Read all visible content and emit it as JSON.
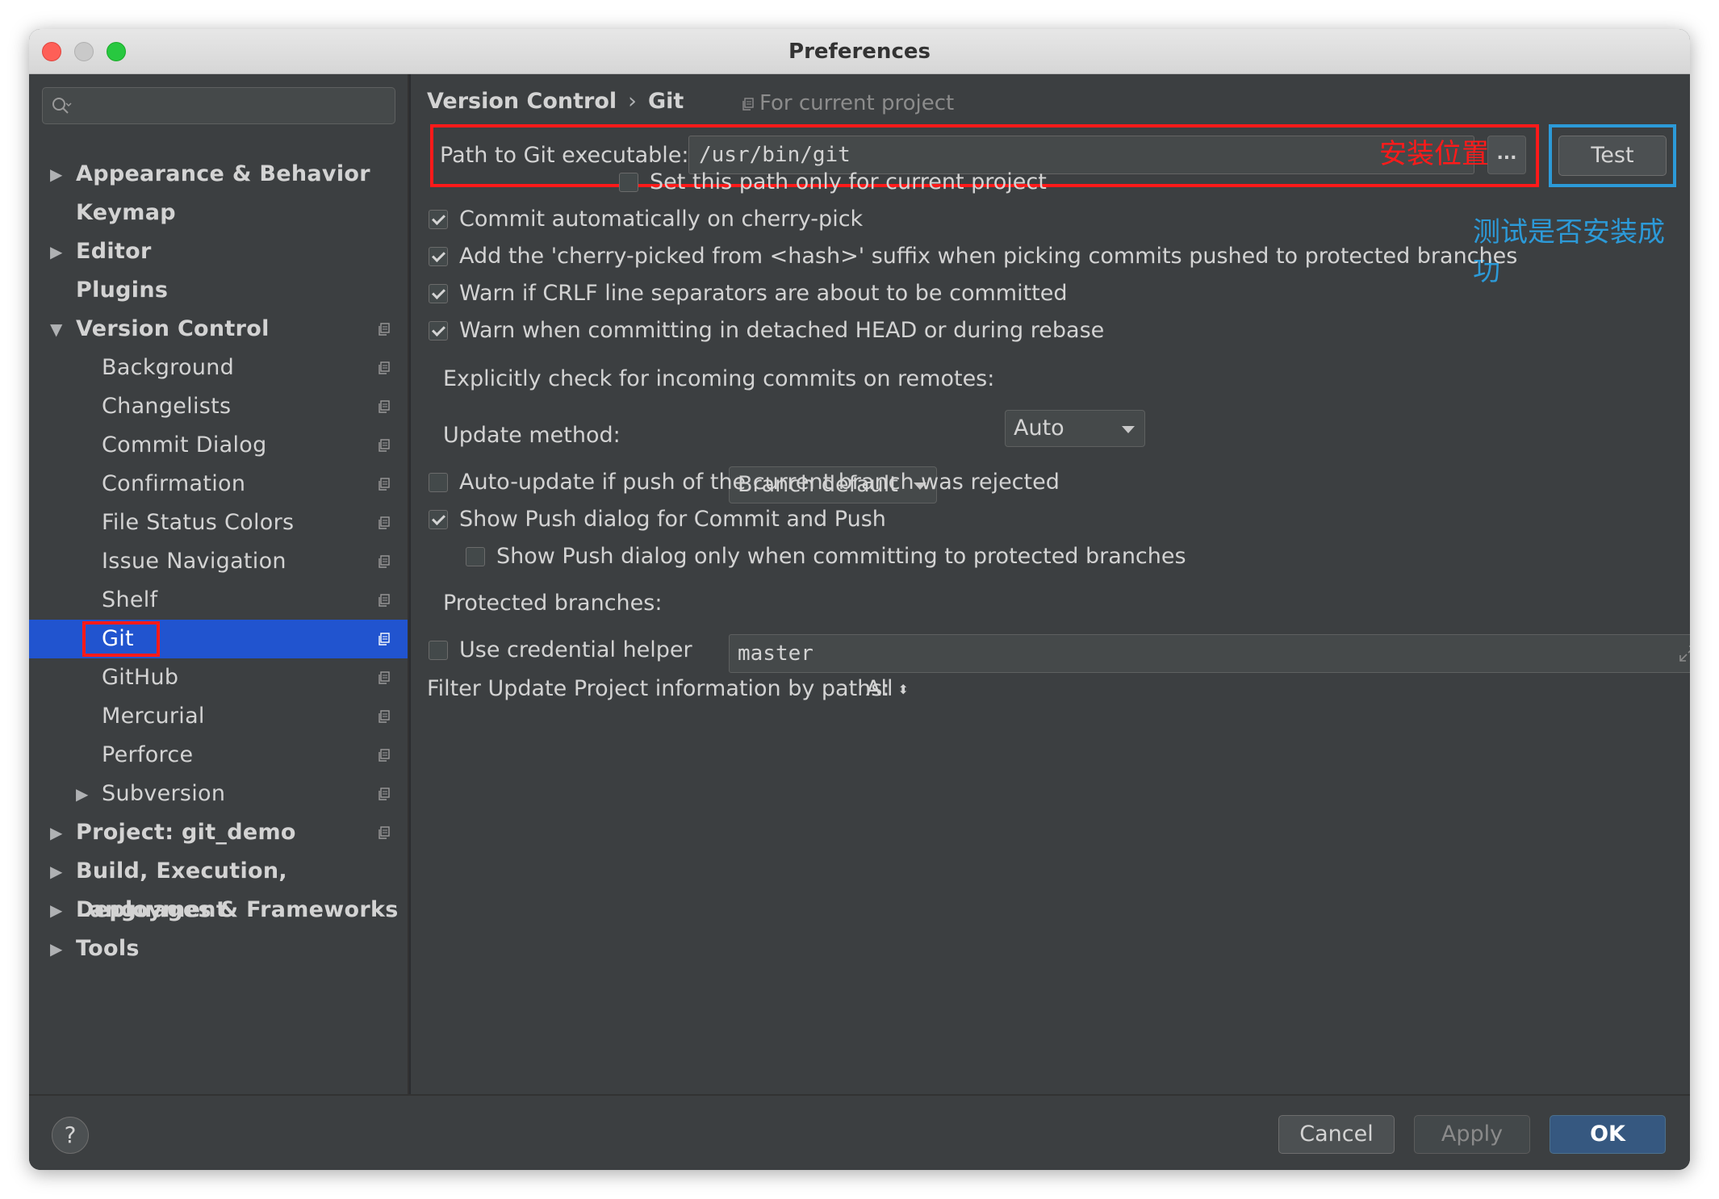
{
  "window": {
    "title": "Preferences"
  },
  "sidebar": {
    "search_placeholder": "",
    "items": [
      {
        "label": "Appearance & Behavior",
        "level": 0,
        "arrow": "▶",
        "bold": true
      },
      {
        "label": "Keymap",
        "level": 0,
        "arrow": "",
        "bold": true
      },
      {
        "label": "Editor",
        "level": 0,
        "arrow": "▶",
        "bold": true
      },
      {
        "label": "Plugins",
        "level": 0,
        "arrow": "",
        "bold": true
      },
      {
        "label": "Version Control",
        "level": 0,
        "arrow": "▼",
        "bold": true,
        "project_icon": true
      },
      {
        "label": "Background",
        "level": 1,
        "arrow": "",
        "project_icon": true
      },
      {
        "label": "Changelists",
        "level": 1,
        "arrow": "",
        "project_icon": true
      },
      {
        "label": "Commit Dialog",
        "level": 1,
        "arrow": "",
        "project_icon": true
      },
      {
        "label": "Confirmation",
        "level": 1,
        "arrow": "",
        "project_icon": true
      },
      {
        "label": "File Status Colors",
        "level": 1,
        "arrow": "",
        "project_icon": true
      },
      {
        "label": "Issue Navigation",
        "level": 1,
        "arrow": "",
        "project_icon": true
      },
      {
        "label": "Shelf",
        "level": 1,
        "arrow": "",
        "project_icon": true
      },
      {
        "label": "Git",
        "level": 1,
        "arrow": "",
        "project_icon": true,
        "selected": true
      },
      {
        "label": "GitHub",
        "level": 1,
        "arrow": "",
        "project_icon": true
      },
      {
        "label": "Mercurial",
        "level": 1,
        "arrow": "",
        "project_icon": true
      },
      {
        "label": "Perforce",
        "level": 1,
        "arrow": "",
        "project_icon": true
      },
      {
        "label": "Subversion",
        "level": 1,
        "arrow": "▶",
        "project_icon": true
      },
      {
        "label": "Project: git_demo",
        "level": 0,
        "arrow": "▶",
        "bold": true,
        "project_icon": true
      },
      {
        "label": "Build, Execution, Deployment",
        "level": 0,
        "arrow": "▶",
        "bold": true
      },
      {
        "label": "Languages & Frameworks",
        "level": 0,
        "arrow": "▶",
        "bold": true
      },
      {
        "label": "Tools",
        "level": 0,
        "arrow": "▶",
        "bold": true
      }
    ]
  },
  "main": {
    "breadcrumb": {
      "parent": "Version Control",
      "separator": "›",
      "current": "Git"
    },
    "for_current_project": "For current project",
    "path": {
      "label": "Path to Git executable:",
      "value": "/usr/bin/git",
      "annotation": "安装位置",
      "browse_label": "...",
      "test_label": "Test",
      "test_annotation": "测试是否安装成功"
    },
    "options": {
      "set_path_only": {
        "label": "Set this path only for current project",
        "checked": false
      },
      "commit_auto": {
        "label": "Commit automatically on cherry-pick",
        "checked": true
      },
      "cherry_suffix": {
        "label": "Add the 'cherry-picked from <hash>' suffix when picking commits pushed to protected branches",
        "checked": true
      },
      "warn_crlf": {
        "label": "Warn if CRLF line separators are about to be committed",
        "checked": true
      },
      "warn_detached": {
        "label": "Warn when committing in detached HEAD or during rebase",
        "checked": true
      },
      "auto_update": {
        "label": "Auto-update if push of the current branch was rejected",
        "checked": false
      },
      "show_push": {
        "label": "Show Push dialog for Commit and Push",
        "checked": true
      },
      "show_push_protected": {
        "label": "Show Push dialog only when committing to protected branches",
        "checked": false
      },
      "credential": {
        "label": "Use credential helper",
        "checked": false
      }
    },
    "incoming": {
      "label": "Explicitly check for incoming commits on remotes:",
      "value": "Auto"
    },
    "update_method": {
      "label": "Update method:",
      "value": "Branch default"
    },
    "protected": {
      "label": "Protected branches:",
      "value": "master"
    },
    "filter": {
      "label": "Filter Update Project information by paths:",
      "value": "All"
    }
  },
  "footer": {
    "help_label": "?",
    "cancel_label": "Cancel",
    "apply_label": "Apply",
    "ok_label": "OK"
  },
  "colors": {
    "selection": "#2154cf",
    "annotation_red": "#ff1a1a",
    "annotation_blue": "#2c9ad8",
    "ok_button": "#365880"
  }
}
